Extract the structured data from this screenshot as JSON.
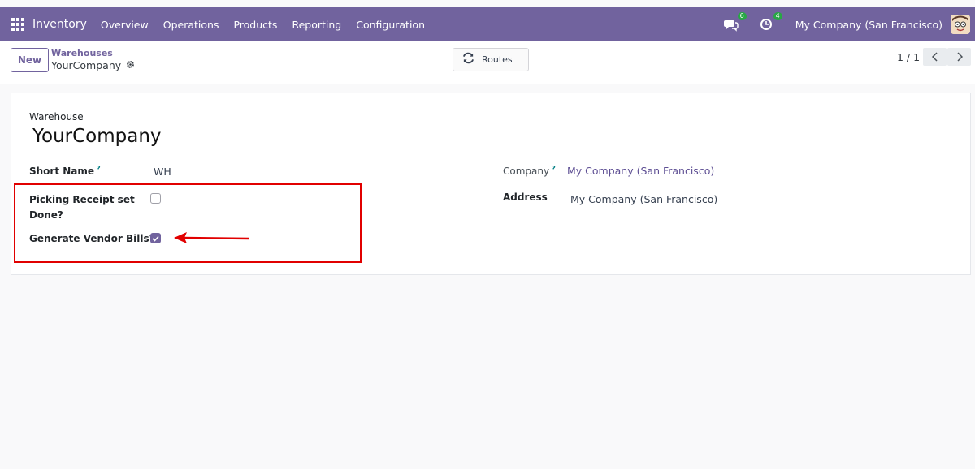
{
  "topbar": {
    "brand": "Inventory",
    "menu": [
      "Overview",
      "Operations",
      "Products",
      "Reporting",
      "Configuration"
    ],
    "messages_badge": "6",
    "activities_badge": "4",
    "company": "My Company (San Francisco)"
  },
  "control": {
    "new_label": "New",
    "breadcrumb_parent": "Warehouses",
    "breadcrumb_current": "YourCompany",
    "routes_label": "Routes",
    "pager": "1 / 1"
  },
  "form": {
    "caption": "Warehouse",
    "title": "YourCompany",
    "short_name_label": "Short Name",
    "help_mark": "?",
    "short_name_value": "WH",
    "picking_receipt_label": "Picking Receipt set Done?",
    "picking_receipt_checked": false,
    "vendor_bills_label": "Generate Vendor Bills?",
    "vendor_bills_checked": true,
    "company_label": "Company",
    "company_value": "My Company (San Francisco)",
    "address_label": "Address",
    "address_value": "My Company (San Francisco)"
  },
  "colors": {
    "brand": "#71639e",
    "highlight": "#e10000",
    "badge": "#28a745"
  }
}
